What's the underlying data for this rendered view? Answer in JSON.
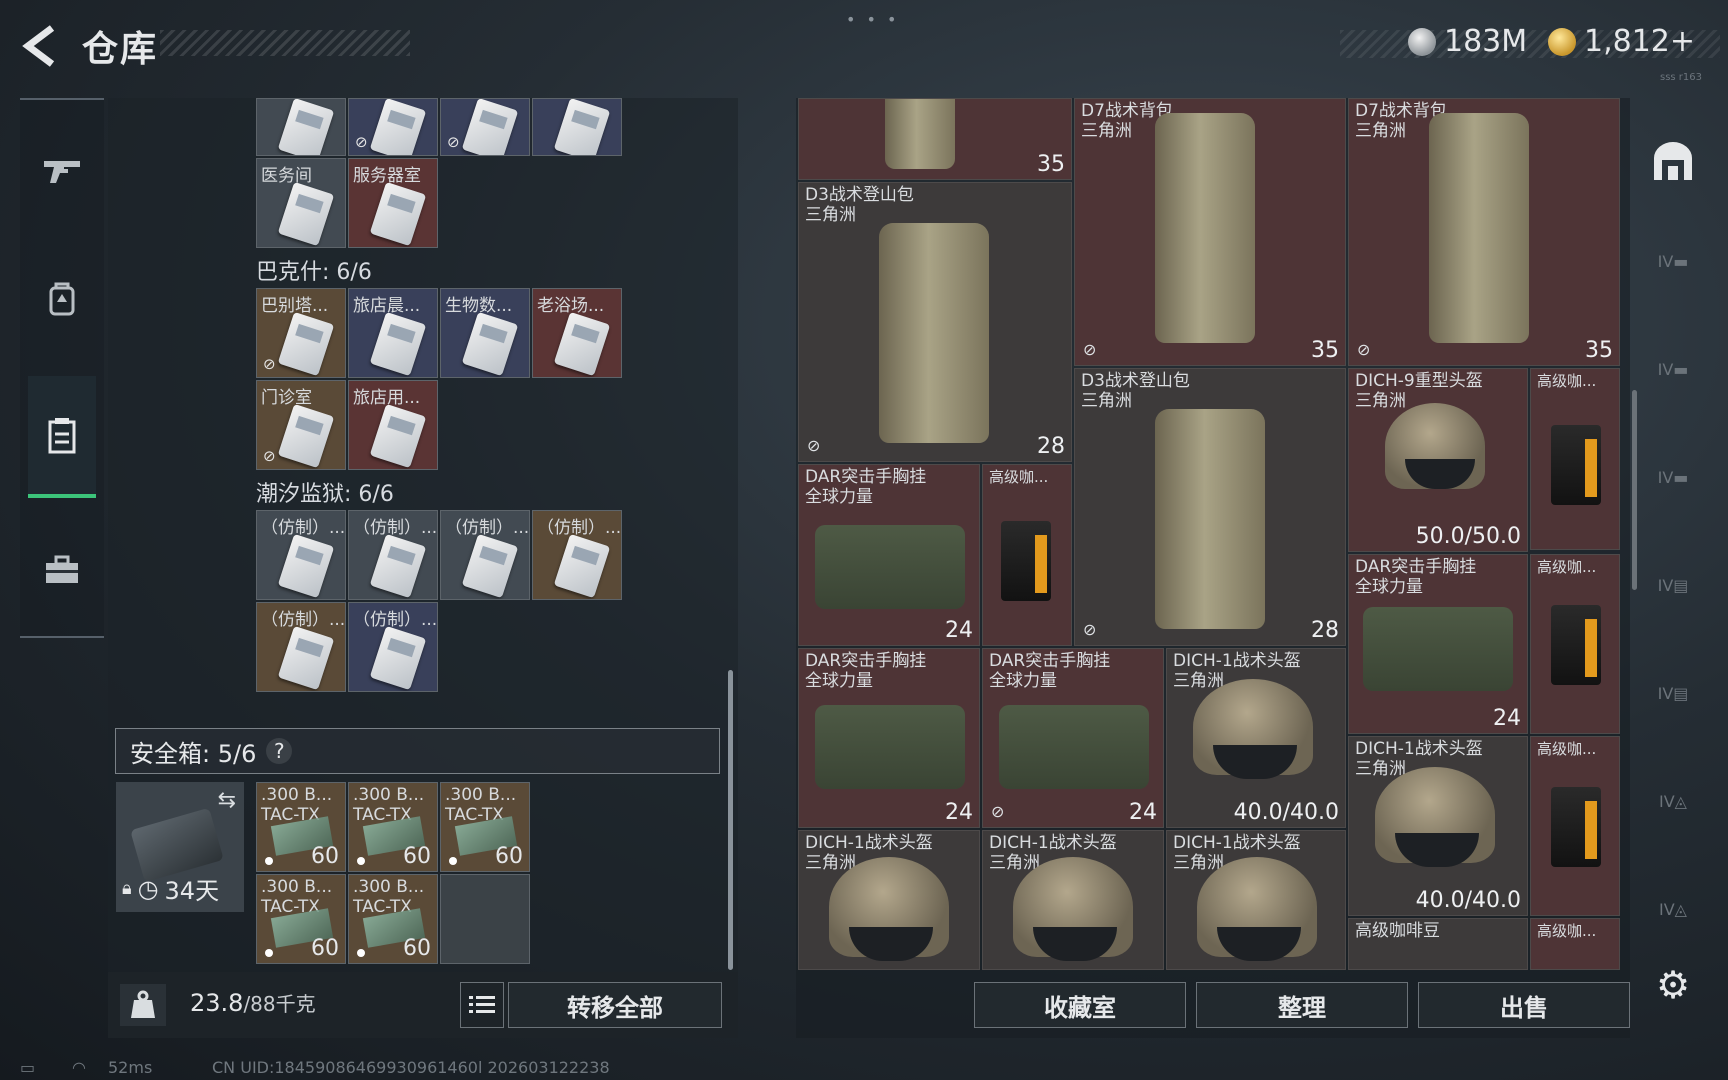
{
  "header": {
    "title": "仓库",
    "top_dots": "• • •",
    "currency_silver": "183M",
    "currency_gold": "1,812+",
    "small_tag": "sss  r163"
  },
  "left_panel": {
    "top_row_cells": [
      "",
      "",
      "",
      ""
    ],
    "row1": [
      {
        "label": "医务间"
      },
      {
        "label": "服务器室"
      }
    ],
    "section_bakesh": "巴克什: 6/6",
    "bakesh_row1": [
      {
        "label": "巴别塔..."
      },
      {
        "label": "旅店晨..."
      },
      {
        "label": "生物数..."
      },
      {
        "label": "老浴场..."
      }
    ],
    "bakesh_row2": [
      {
        "label": "门诊室"
      },
      {
        "label": "旅店用..."
      }
    ],
    "section_prison": "潮汐监狱: 6/6",
    "prison_row1": [
      {
        "label": "（仿制）..."
      },
      {
        "label": "（仿制）..."
      },
      {
        "label": "（仿制）..."
      },
      {
        "label": "（仿制）..."
      }
    ],
    "prison_row2": [
      {
        "label": "（仿制）..."
      },
      {
        "label": "（仿制）..."
      }
    ],
    "safe_box_label": "安全箱: 5/6",
    "safe_box_help": "?",
    "safe_box_days": "34天",
    "ammo": [
      {
        "label": ".300 B... TAC-TX",
        "qty": "60"
      },
      {
        "label": ".300 B... TAC-TX",
        "qty": "60"
      },
      {
        "label": ".300 B... TAC-TX",
        "qty": "60"
      },
      {
        "label": ".300 B... TAC-TX",
        "qty": "60"
      },
      {
        "label": ".300 B... TAC-TX",
        "qty": "60"
      }
    ],
    "weight_value": "23.8",
    "weight_cap": "/88千克",
    "transfer_all": "转移全部"
  },
  "right_panel": {
    "items": [
      {
        "name": "",
        "value": "35"
      },
      {
        "name": "D7战术背包\n三角洲",
        "value": "35"
      },
      {
        "name": "D7战术背包\n三角洲",
        "value": "35"
      },
      {
        "name": "D3战术登山包\n三角洲",
        "value": "28"
      },
      {
        "name": "D3战术登山包\n三角洲",
        "value": "28"
      },
      {
        "name": "DICH-9重型头盔\n三角洲",
        "value": "50.0/50.0"
      },
      {
        "name": "高级咖...",
        "value": ""
      },
      {
        "name": "DAR突击手胸挂\n全球力量",
        "value": "24"
      },
      {
        "name": "高级咖...",
        "value": ""
      },
      {
        "name": "DAR突击手胸挂\n全球力量",
        "value": "24"
      },
      {
        "name": "高级咖...",
        "value": ""
      },
      {
        "name": "DAR突击手胸挂\n全球力量",
        "value": "24"
      },
      {
        "name": "DAR突击手胸挂\n全球力量",
        "value": "24"
      },
      {
        "name": "DICH-1战术头盔\n三角洲",
        "value": "40.0/40.0"
      },
      {
        "name": "DICH-1战术头盔\n三角洲",
        "value": "40.0/40.0"
      },
      {
        "name": "高级咖...",
        "value": ""
      },
      {
        "name": "DICH-1战术头盔\n三角洲",
        "value": ""
      },
      {
        "name": "DICH-1战术头盔\n三角洲",
        "value": ""
      },
      {
        "name": "DICH-1战术头盔\n三角洲",
        "value": ""
      },
      {
        "name": "高级咖啡豆",
        "value": ""
      },
      {
        "name": "高级咖...",
        "value": ""
      }
    ],
    "btn_collection": "收藏室",
    "btn_sort": "整理",
    "btn_sell": "出售"
  },
  "right_rail": {
    "tier_labels": [
      "IV",
      "IV",
      "IV",
      "IV",
      "IV",
      "IV",
      "IV"
    ]
  },
  "status_bar": {
    "ping": "52ms",
    "uid": "CN UID:18459086469930961460l 202603122238"
  },
  "colors": {
    "accent_green": "#3cc47a",
    "cell_red": "#5a3434",
    "cell_blue": "#39405a",
    "cell_brown": "#5a4a37"
  }
}
